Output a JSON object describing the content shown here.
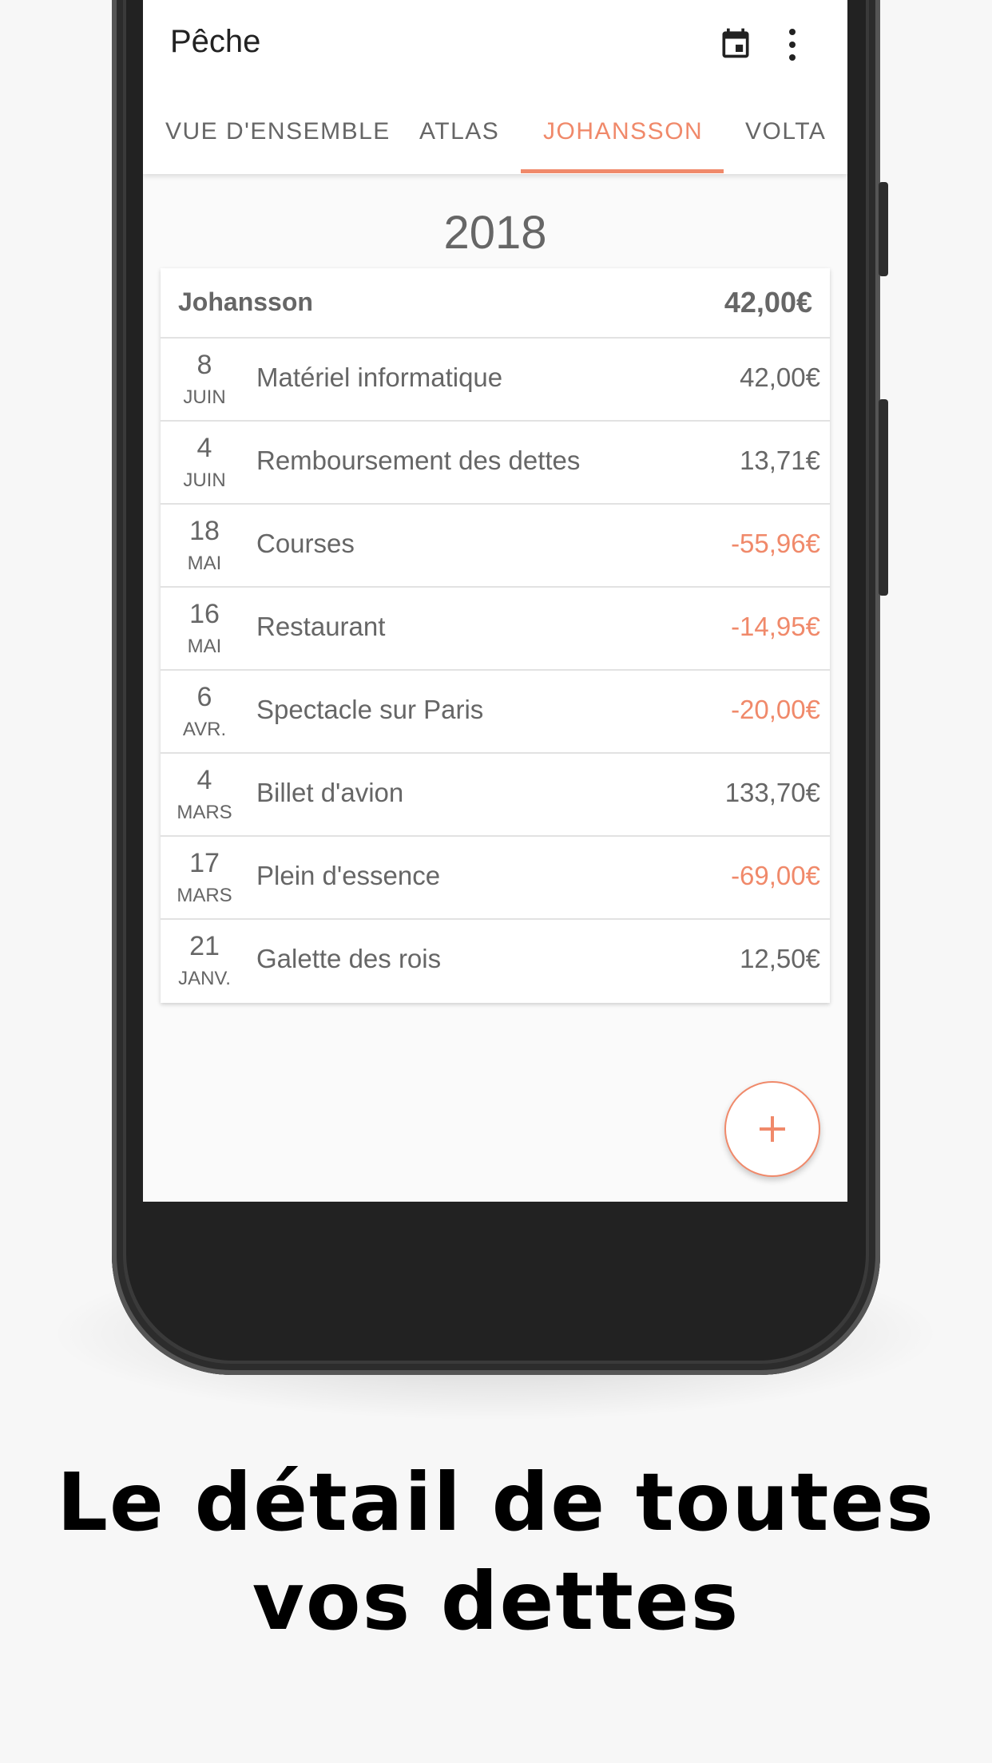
{
  "app": {
    "title": "Pêche",
    "icons": [
      "calendar-icon",
      "more-vert-icon"
    ],
    "accent_color": "#f0896a"
  },
  "tabs": [
    {
      "label": "VUE D'ENSEMBLE",
      "active": false
    },
    {
      "label": "ATLAS",
      "active": false
    },
    {
      "label": "JOHANSSON",
      "active": true
    },
    {
      "label": "VOLTA",
      "active": false
    }
  ],
  "year": "2018",
  "card": {
    "name": "Johansson",
    "total": "42,00€",
    "rows": [
      {
        "day": "8",
        "month": "JUIN",
        "label": "Matériel informatique",
        "amount": "42,00€",
        "negative": false
      },
      {
        "day": "4",
        "month": "JUIN",
        "label": "Remboursement des dettes",
        "amount": "13,71€",
        "negative": false
      },
      {
        "day": "18",
        "month": "MAI",
        "label": "Courses",
        "amount": "-55,96€",
        "negative": true
      },
      {
        "day": "16",
        "month": "MAI",
        "label": "Restaurant",
        "amount": "-14,95€",
        "negative": true
      },
      {
        "day": "6",
        "month": "AVR.",
        "label": "Spectacle sur Paris",
        "amount": "-20,00€",
        "negative": true
      },
      {
        "day": "4",
        "month": "MARS",
        "label": "Billet d'avion",
        "amount": "133,70€",
        "negative": false
      },
      {
        "day": "17",
        "month": "MARS",
        "label": "Plein d'essence",
        "amount": "-69,00€",
        "negative": true
      },
      {
        "day": "21",
        "month": "JANV.",
        "label": "Galette des rois",
        "amount": "12,50€",
        "negative": false
      }
    ]
  },
  "fab": {
    "icon": "plus-icon"
  },
  "caption": {
    "line1": "Le détail de toutes",
    "line2": "vos dettes"
  }
}
